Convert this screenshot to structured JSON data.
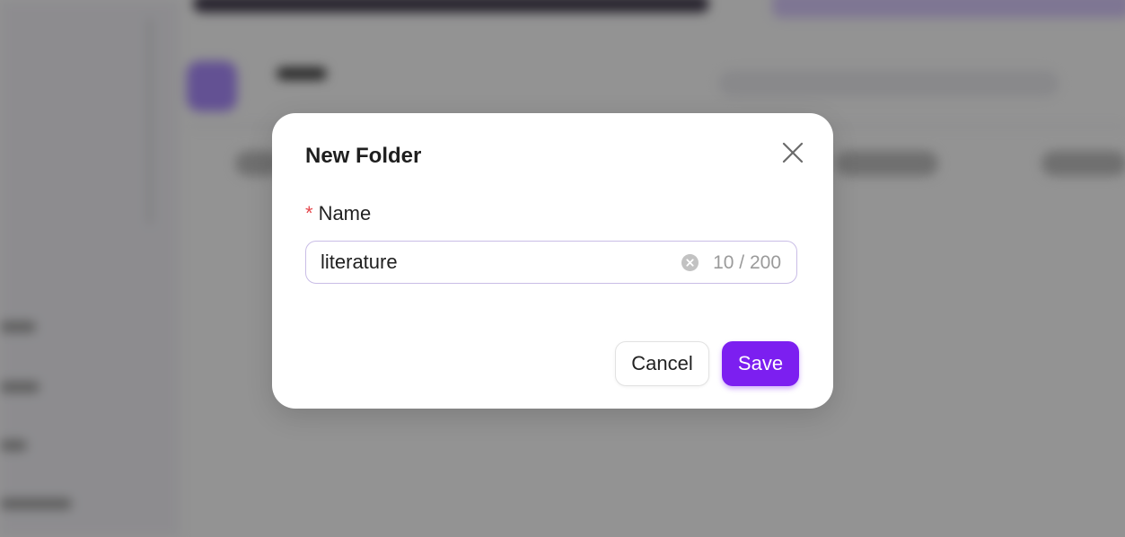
{
  "modal": {
    "title": "New Folder",
    "close_icon": "close-icon",
    "field": {
      "required_mark": "*",
      "label": "Name",
      "value": "literature",
      "counter": "10 / 200",
      "clear_icon": "clear-circle-icon"
    },
    "actions": {
      "cancel_label": "Cancel",
      "save_label": "Save"
    }
  },
  "colors": {
    "accent": "#7c1ff0",
    "required": "#e5484d",
    "overlay": "rgba(20,20,20,0.46)"
  }
}
